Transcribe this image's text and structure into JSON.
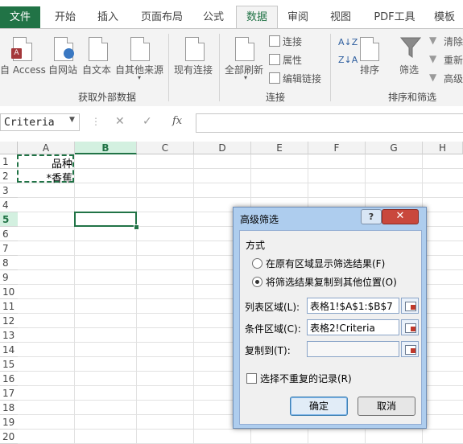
{
  "ribbon": {
    "tabs": {
      "file": "文件",
      "home": "开始",
      "insert": "插入",
      "page_layout": "页面布局",
      "formulas": "公式",
      "data": "数据",
      "review": "审阅",
      "view": "视图",
      "pdf_tools": "PDF工具",
      "template": "模板"
    },
    "get_external": {
      "access": "自 Access",
      "web": "自网站",
      "text": "自文本",
      "other": "自其他来源",
      "existing": "现有连接",
      "group_label": "获取外部数据"
    },
    "connections": {
      "refresh_all": "全部刷新",
      "connections": "连接",
      "properties": "属性",
      "edit_links": "编辑链接",
      "group_label": "连接"
    },
    "sort_filter": {
      "sort": "排序",
      "filter": "筛选",
      "clear": "清除",
      "reapply": "重新",
      "advanced": "高级",
      "group_label": "排序和筛选"
    }
  },
  "formula_bar": {
    "name_box": "Criteria",
    "fx_label": "fx",
    "formula": ""
  },
  "sheet": {
    "columns": [
      "A",
      "B",
      "C",
      "D",
      "E",
      "F",
      "G",
      "H"
    ],
    "rows": [
      "1",
      "2",
      "3",
      "4",
      "5",
      "6",
      "7",
      "8",
      "9",
      "10",
      "11",
      "12",
      "13",
      "14",
      "15",
      "16",
      "17",
      "18",
      "19",
      "20"
    ],
    "cells": {
      "A1": "品种",
      "A2": "*香蕉"
    },
    "active_cell": "B5",
    "accent_color": "#217346"
  },
  "dialog": {
    "title": "高级筛选",
    "help_label": "?",
    "close_label": "✕",
    "mode_section": "方式",
    "option_in_place": "在原有区域显示筛选结果(F)",
    "option_copy": "将筛选结果复制到其他位置(O)",
    "selected_option": "copy",
    "list_range_label": "列表区域(L):",
    "list_range_value": "表格1!$A$1:$B$7",
    "criteria_range_label": "条件区域(C):",
    "criteria_range_value": "表格2!Criteria",
    "copy_to_label": "复制到(T):",
    "copy_to_value": "",
    "unique_label": "选择不重复的记录(R)",
    "unique_checked": false,
    "ok_label": "确定",
    "cancel_label": "取消"
  }
}
